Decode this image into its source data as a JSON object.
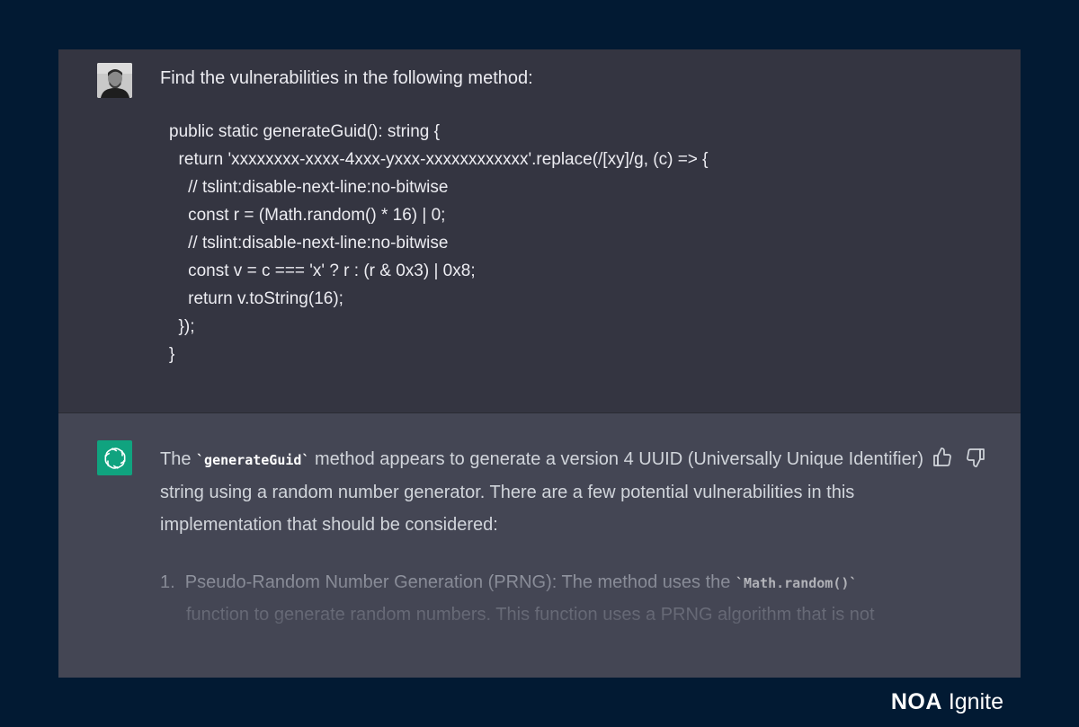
{
  "user_message": {
    "prompt": "Find the vulnerabilities in the following method:",
    "code_lines": [
      "public static generateGuid(): string {",
      "  return 'xxxxxxxx-xxxx-4xxx-yxxx-xxxxxxxxxxxx'.replace(/[xy]/g, (c) => {",
      "    // tslint:disable-next-line:no-bitwise",
      "    const r = (Math.random() * 16) | 0;",
      "    // tslint:disable-next-line:no-bitwise",
      "    const v = c === 'x' ? r : (r & 0x3) | 0x8;",
      "    return v.toString(16);",
      "  });",
      "}"
    ]
  },
  "assistant_message": {
    "intro_before": "The ",
    "intro_code": "`generateGuid`",
    "intro_after": " method appears to generate a version 4 UUID (Universally Unique Identifier) string using a random number generator. There are a few potential vulnerabilities in this implementation that should be considered:",
    "item1_prefix": "1.  Pseudo-Random Number Generation (PRNG): The method uses the ",
    "item1_code": "`Math.random()`",
    "item1_continued": "function to generate random numbers. This function uses a PRNG algorithm that is not"
  },
  "icons": {
    "user_avatar": "user-avatar",
    "assistant_avatar": "openai-logo-icon",
    "thumbs_up": "thumbs-up-icon",
    "thumbs_down": "thumbs-down-icon"
  },
  "brand": {
    "name_bold": "NOA",
    "name_light": "Ignite"
  },
  "colors": {
    "background": "#021a33",
    "user_bg": "#343541",
    "assistant_bg": "#444654",
    "assistant_avatar": "#10a37f"
  }
}
